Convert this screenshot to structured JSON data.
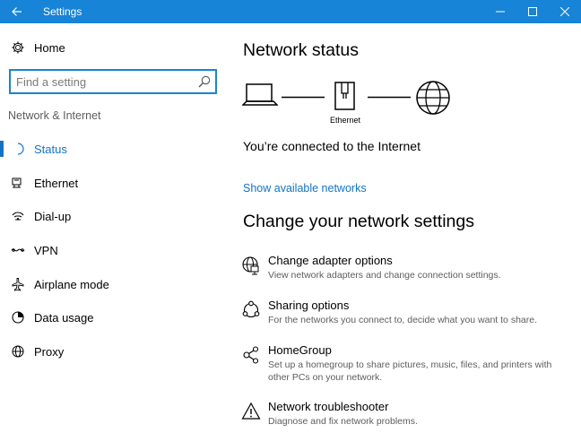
{
  "window": {
    "title": "Settings",
    "accent": "#1884d7"
  },
  "sidebar": {
    "home_label": "Home",
    "search": {
      "placeholder": "Find a setting",
      "value": ""
    },
    "section_label": "Network & Internet",
    "items": [
      {
        "label": "Status",
        "icon": "status-icon",
        "active": true
      },
      {
        "label": "Ethernet",
        "icon": "ethernet-icon"
      },
      {
        "label": "Dial-up",
        "icon": "dialup-icon"
      },
      {
        "label": "VPN",
        "icon": "vpn-icon"
      },
      {
        "label": "Airplane mode",
        "icon": "airplane-icon"
      },
      {
        "label": "Data usage",
        "icon": "data-usage-icon"
      },
      {
        "label": "Proxy",
        "icon": "proxy-icon"
      }
    ]
  },
  "main": {
    "network_status_title": "Network status",
    "diagram": {
      "adapter_label": "Ethernet"
    },
    "connected_text": "You’re connected to the Internet",
    "show_networks_link": "Show available networks",
    "change_settings_title": "Change your network settings",
    "options": [
      {
        "title": "Change adapter options",
        "description": "View network adapters and change connection settings.",
        "icon": "adapter-globe-icon"
      },
      {
        "title": "Sharing options",
        "description": "For the networks you connect to, decide what you want to share.",
        "icon": "sharing-icon"
      },
      {
        "title": "HomeGroup",
        "description": "Set up a homegroup to share pictures, music, files, and printers with other PCs on your network.",
        "icon": "homegroup-icon"
      },
      {
        "title": "Network troubleshooter",
        "description": "Diagnose and fix network problems.",
        "icon": "warning-icon"
      }
    ]
  }
}
